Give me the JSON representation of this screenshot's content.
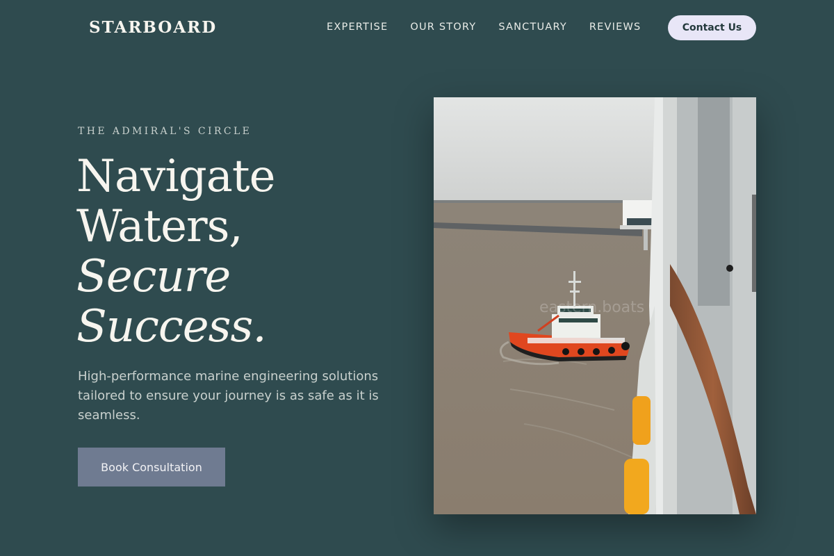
{
  "header": {
    "brand": "STARBOARD",
    "nav": [
      "EXPERTISE",
      "OUR STORY",
      "SANCTUARY",
      "REVIEWS"
    ],
    "contact_label": "Contact Us"
  },
  "hero": {
    "eyebrow": "THE ADMIRAL'S CIRCLE",
    "headline_line1": "Navigate",
    "headline_line2": "Waters,",
    "headline_line3": "Secure",
    "headline_line4": "Success.",
    "lede": "High-performance marine engineering solutions tailored to ensure your journey is as safe as it is seamless.",
    "cta_label": "Book Consultation",
    "image_watermark": "eastern.boats"
  },
  "colors": {
    "background": "#2f4b4f",
    "contact_button": "#e8e6f7",
    "cta_button": "#6f7b91"
  }
}
